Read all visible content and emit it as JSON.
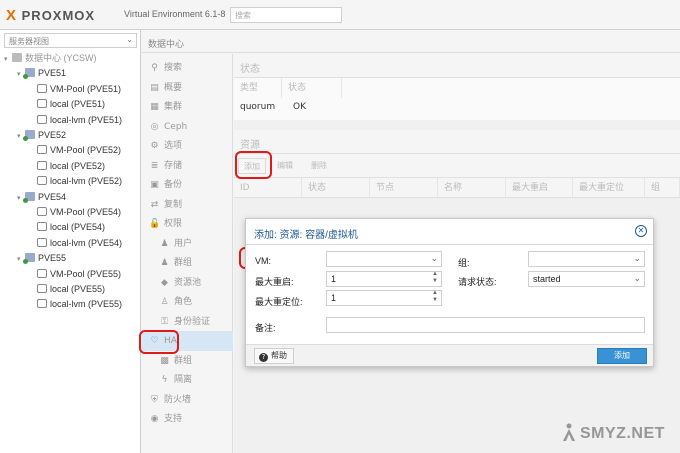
{
  "header": {
    "logo_x": "X",
    "logo_text": "PROXMOX",
    "version": "Virtual Environment 6.1-8",
    "search_placeholder": "搜索"
  },
  "tree": {
    "view_selector": "服务器视图",
    "datacenter": "数据中心 (YCSW)",
    "nodes": [
      {
        "name": "PVE51",
        "storages": [
          "VM-Pool (PVE51)",
          "local (PVE51)",
          "local-lvm (PVE51)"
        ]
      },
      {
        "name": "PVE52",
        "storages": [
          "VM-Pool (PVE52)",
          "local (PVE52)",
          "local-lvm (PVE52)"
        ]
      },
      {
        "name": "PVE54",
        "storages": [
          "VM-Pool (PVE54)",
          "local (PVE54)",
          "local-lvm (PVE54)"
        ]
      },
      {
        "name": "PVE55",
        "storages": [
          "VM-Pool (PVE55)",
          "local (PVE55)",
          "local-lvm (PVE55)"
        ]
      }
    ]
  },
  "content": {
    "breadcrumb": "数据中心",
    "nav": [
      {
        "label": "搜索",
        "icon": "search-icon",
        "glyph": "⚲"
      },
      {
        "label": "概要",
        "icon": "book-icon",
        "glyph": "▤"
      },
      {
        "label": "集群",
        "icon": "server-icon",
        "glyph": "▦"
      },
      {
        "label": "Ceph",
        "icon": "ceph-icon",
        "glyph": "◎"
      },
      {
        "label": "选项",
        "icon": "gear-icon",
        "glyph": "⚙"
      },
      {
        "label": "存储",
        "icon": "database-icon",
        "glyph": "≣"
      },
      {
        "label": "备份",
        "icon": "floppy-icon",
        "glyph": "▣"
      },
      {
        "label": "复制",
        "icon": "retweet-icon",
        "glyph": "⇄"
      },
      {
        "label": "权限",
        "icon": "unlock-icon",
        "glyph": "🔓"
      },
      {
        "label": "用户",
        "icon": "user-icon",
        "glyph": "♟"
      },
      {
        "label": "群组",
        "icon": "users-icon",
        "glyph": "♟"
      },
      {
        "label": "资源池",
        "icon": "tags-icon",
        "glyph": "◆"
      },
      {
        "label": "角色",
        "icon": "male-icon",
        "glyph": "♙"
      },
      {
        "label": "身份验证",
        "icon": "key-icon",
        "glyph": "⚿"
      },
      {
        "label": "HA",
        "icon": "heartbeat-icon",
        "glyph": "♡"
      },
      {
        "label": "群组",
        "icon": "object-group-icon",
        "glyph": "▩"
      },
      {
        "label": "隔离",
        "icon": "bolt-icon",
        "glyph": "ϟ"
      },
      {
        "label": "防火墙",
        "icon": "shield-icon",
        "glyph": "⛨"
      },
      {
        "label": "支持",
        "icon": "life-ring-icon",
        "glyph": "◉"
      }
    ],
    "status_panel": {
      "title": "状态",
      "col_type": "类型",
      "col_status": "状态",
      "row_type": "quorum",
      "row_status": "OK"
    },
    "resources_panel": {
      "title": "资源",
      "add": "添加",
      "edit": "编辑",
      "remove": "删除",
      "columns": [
        "ID",
        "状态",
        "节点",
        "名称",
        "最大重启",
        "最大重定位",
        "组"
      ]
    }
  },
  "dialog": {
    "title": "添加: 资源: 容器/虚拟机",
    "vm_label": "VM:",
    "vm_value": "",
    "max_restart_label": "最大重启:",
    "max_restart_value": "1",
    "max_relocate_label": "最大重定位:",
    "max_relocate_value": "1",
    "group_label": "组:",
    "group_value": "",
    "request_state_label": "请求状态:",
    "request_state_value": "started",
    "comment_label": "备注:",
    "comment_value": "",
    "help": "帮助",
    "add": "添加"
  },
  "watermark": {
    "text": "SMYZ.NET"
  },
  "colors": {
    "accent": "#3892d4",
    "title_blue": "#1f5a92",
    "annotation_red": "#e01a1a",
    "logo_orange": "#e57000",
    "status_green": "#3c9b3c"
  }
}
